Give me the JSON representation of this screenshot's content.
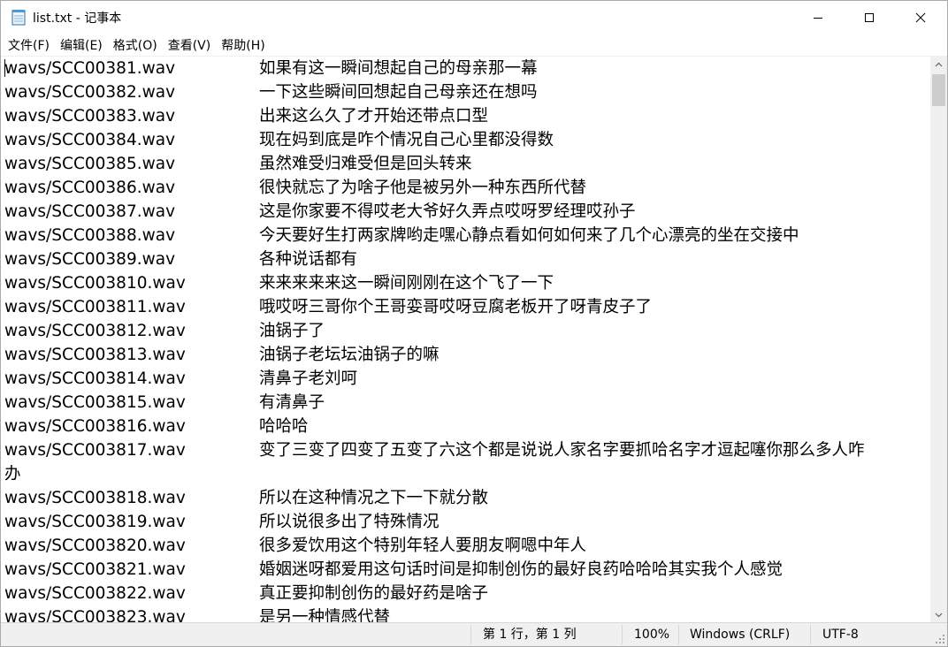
{
  "window": {
    "title": "list.txt - 记事本",
    "icon": "notepad-icon"
  },
  "menu": [
    {
      "label": "文件(F)"
    },
    {
      "label": "编辑(E)"
    },
    {
      "label": "格式(O)"
    },
    {
      "label": "查看(V)"
    },
    {
      "label": "帮助(H)"
    }
  ],
  "lines": [
    {
      "file": "wavs/SCC00381.wav",
      "text": "如果有这一瞬间想起自己的母亲那一幕"
    },
    {
      "file": "wavs/SCC00382.wav",
      "text": "一下这些瞬间回想起自己母亲还在想吗"
    },
    {
      "file": "wavs/SCC00383.wav",
      "text": "出来这么久了才开始还带点口型"
    },
    {
      "file": "wavs/SCC00384.wav",
      "text": "现在妈到底是咋个情况自己心里都没得数"
    },
    {
      "file": "wavs/SCC00385.wav",
      "text": "虽然难受归难受但是回头转来"
    },
    {
      "file": "wavs/SCC00386.wav",
      "text": "很快就忘了为啥子他是被另外一种东西所代替"
    },
    {
      "file": "wavs/SCC00387.wav",
      "text": "这是你家要不得哎老大爷好久弄点哎呀罗经理哎孙子"
    },
    {
      "file": "wavs/SCC00388.wav",
      "text": "今天要好生打两家牌哟走嘿心静点看如何如何来了几个心漂亮的坐在交接中"
    },
    {
      "file": "wavs/SCC00389.wav",
      "text": "各种说话都有"
    },
    {
      "file": "wavs/SCC003810.wav",
      "text": "来来来来来这一瞬间刚刚在这个飞了一下"
    },
    {
      "file": "wavs/SCC003811.wav",
      "text": "哦哎呀三哥你个王哥娈哥哎呀豆腐老板开了呀青皮子了"
    },
    {
      "file": "wavs/SCC003812.wav",
      "text": "油锅子了"
    },
    {
      "file": "wavs/SCC003813.wav",
      "text": "油锅子老坛坛油锅子的嘛"
    },
    {
      "file": "wavs/SCC003814.wav",
      "text": "清鼻子老刘呵"
    },
    {
      "file": "wavs/SCC003815.wav",
      "text": "有清鼻子"
    },
    {
      "file": "wavs/SCC003816.wav",
      "text": "哈哈哈"
    },
    {
      "file": "wavs/SCC003817.wav",
      "text": "变了三变了四变了五变了六这个都是说说人家名字要抓哈名字才逗起噻你那么多人咋",
      "wrap": "办"
    },
    {
      "file": "wavs/SCC003818.wav",
      "text": "所以在这种情况之下一下就分散"
    },
    {
      "file": "wavs/SCC003819.wav",
      "text": "所以说很多出了特殊情况"
    },
    {
      "file": "wavs/SCC003820.wav",
      "text": "很多爱饮用这个特别年轻人要朋友啊嗯中年人"
    },
    {
      "file": "wavs/SCC003821.wav",
      "text": "婚姻迷呀都爱用这句话时间是抑制创伤的最好良药哈哈哈其实我个人感觉"
    },
    {
      "file": "wavs/SCC003822.wav",
      "text": "真正要抑制创伤的最好药是啥子"
    },
    {
      "file": "wavs/SCC003823.wav",
      "text": "是另一种情感代替"
    }
  ],
  "status": {
    "position": "第 1 行，第 1 列",
    "zoom": "100%",
    "line_ending": "Windows (CRLF)",
    "encoding": "UTF-8"
  }
}
